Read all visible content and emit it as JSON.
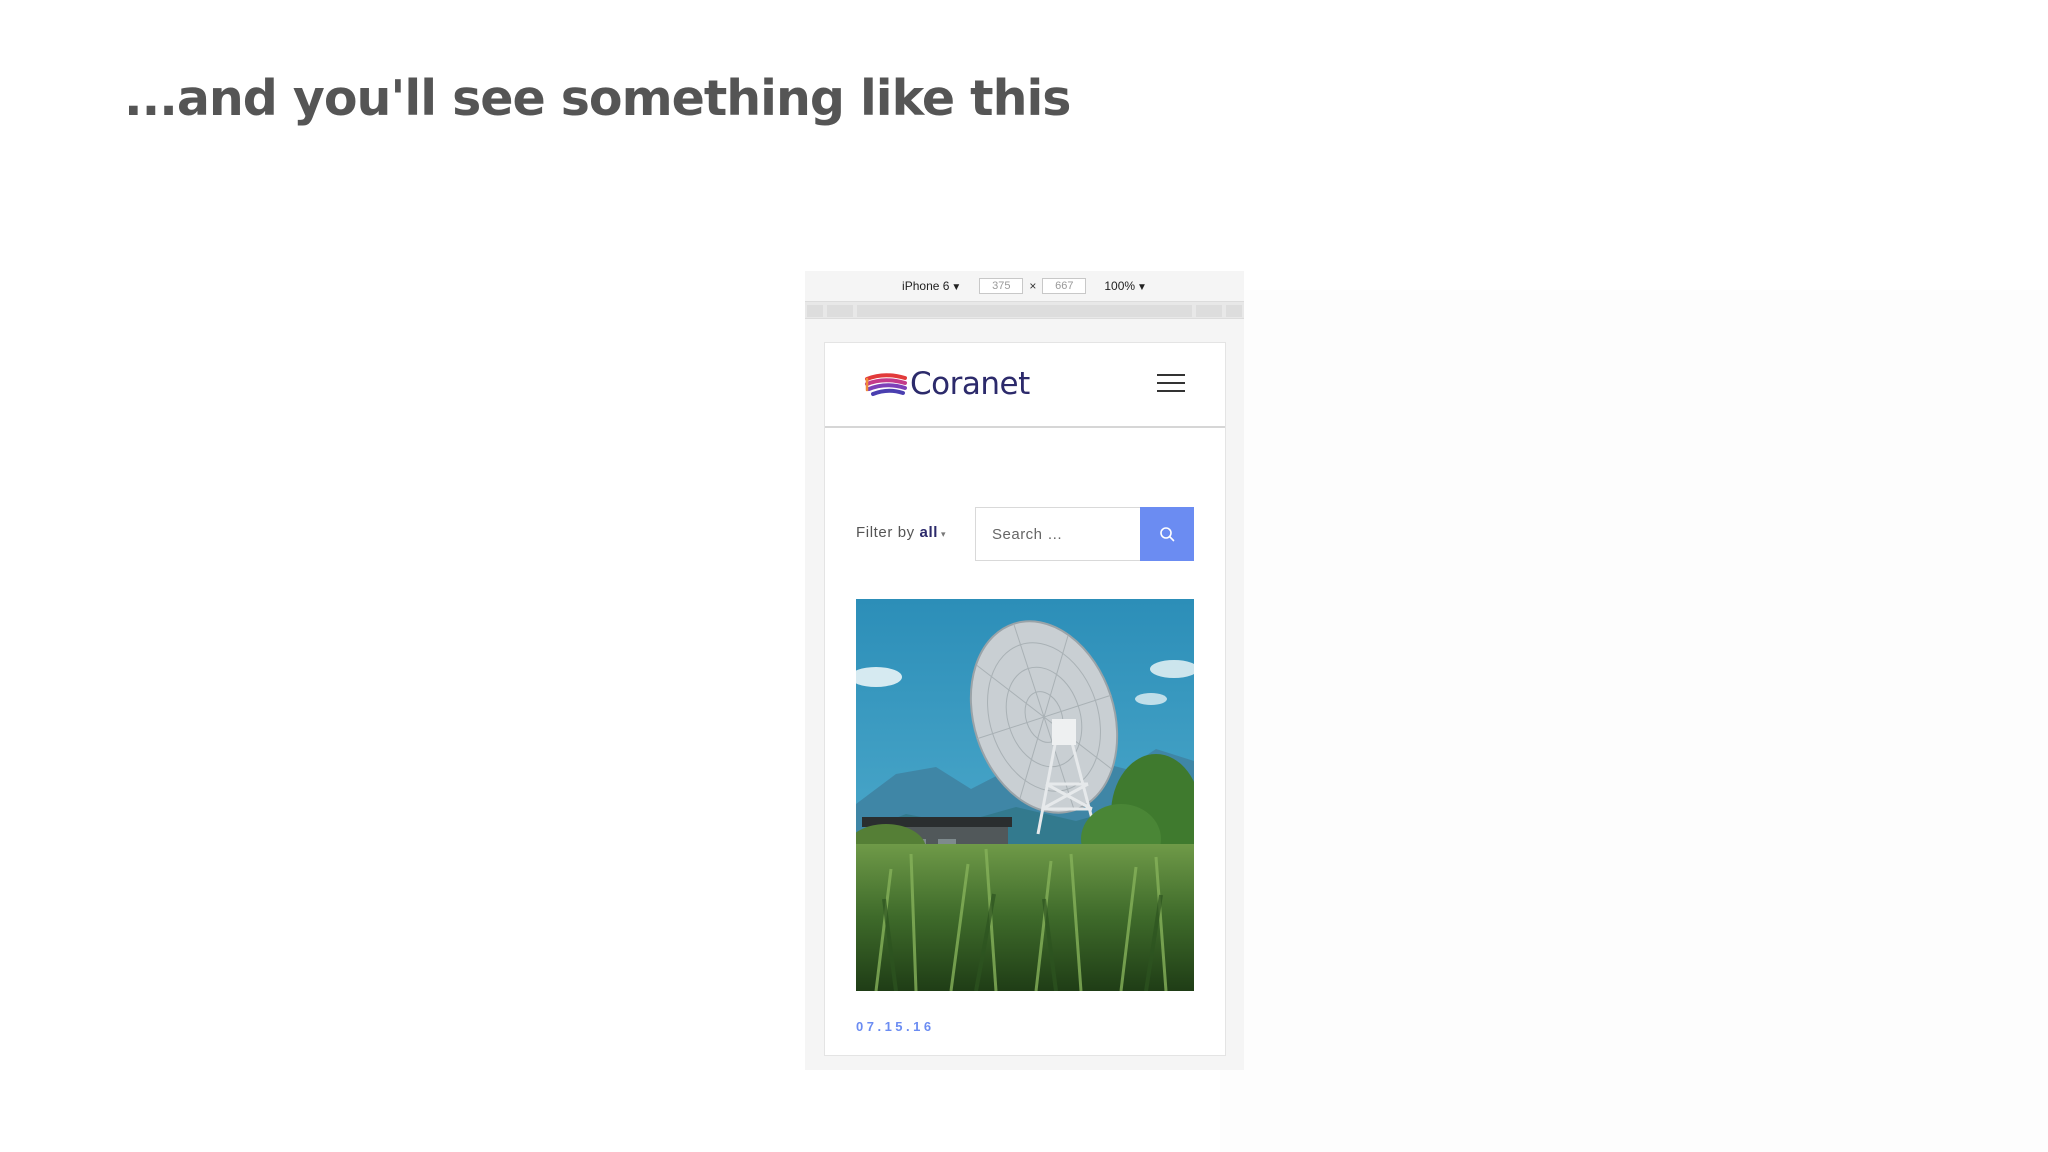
{
  "slide": {
    "title": "...and you'll see something like this"
  },
  "devtools": {
    "device_name": "iPhone 6",
    "device_caret": "▼",
    "width": "375",
    "separator": "×",
    "height": "667",
    "zoom": "100%",
    "zoom_caret": "▼"
  },
  "site": {
    "brand": "Coranet",
    "logo_icon": "coranet-logo-icon",
    "menu_icon": "hamburger-menu-icon",
    "filter": {
      "label": "Filter by",
      "value": "all",
      "caret": "▾"
    },
    "search": {
      "placeholder": "Search …",
      "button_icon": "search-icon"
    },
    "post": {
      "image": "radio-telescope-dish-photo",
      "date": "07.15.16"
    }
  },
  "colors": {
    "accent": "#6b8cf2",
    "brand": "#2c2a6b",
    "title": "#555555"
  }
}
